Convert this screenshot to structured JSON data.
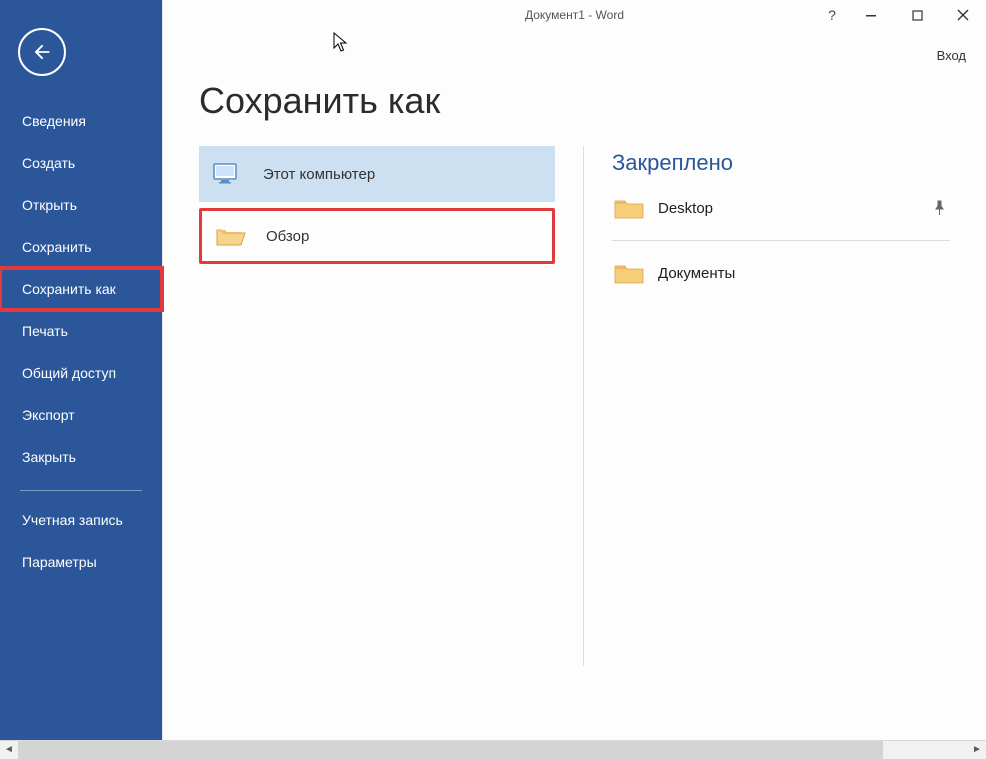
{
  "window": {
    "title": "Документ1 - Word",
    "signin": "Вход"
  },
  "sidebar": {
    "items": [
      {
        "label": "Сведения"
      },
      {
        "label": "Создать"
      },
      {
        "label": "Открыть"
      },
      {
        "label": "Сохранить"
      },
      {
        "label": "Сохранить как"
      },
      {
        "label": "Печать"
      },
      {
        "label": "Общий доступ"
      },
      {
        "label": "Экспорт"
      },
      {
        "label": "Закрыть"
      }
    ],
    "secondary": [
      {
        "label": "Учетная запись"
      },
      {
        "label": "Параметры"
      }
    ]
  },
  "page": {
    "heading": "Сохранить как",
    "locations": [
      {
        "label": "Этот компьютер"
      },
      {
        "label": "Обзор"
      }
    ],
    "pinned_title": "Закреплено",
    "pinned_folders": [
      {
        "label": "Desktop",
        "pinned": true
      }
    ],
    "recent_folders": [
      {
        "label": "Документы"
      }
    ]
  }
}
